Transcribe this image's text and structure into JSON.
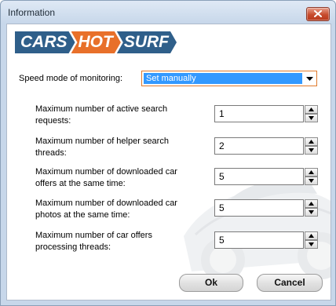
{
  "window": {
    "title": "Information"
  },
  "logo": {
    "segments": [
      {
        "text": "CARS",
        "color": "#2f5f8a"
      },
      {
        "text": "HOT",
        "color": "#e8702a"
      },
      {
        "text": "SURF",
        "color": "#2f5f8a"
      }
    ]
  },
  "speed_mode": {
    "label": "Speed mode of monitoring:",
    "selected": "Set manually"
  },
  "settings": [
    {
      "label_line1": "Maximum number of active search",
      "label_line2": "requests:",
      "value": "1"
    },
    {
      "label_line1": "Maximum number of helper search",
      "label_line2": "threads:",
      "value": "2"
    },
    {
      "label_line1": "Maximum number of downloaded car",
      "label_line2": "offers at the same time:",
      "value": "5"
    },
    {
      "label_line1": "Maximum number of downloaded car",
      "label_line2": "photos at the same time:",
      "value": "5"
    },
    {
      "label_line1": "Maximum number of car offers",
      "label_line2": "processing threads:",
      "value": "5"
    }
  ],
  "buttons": {
    "ok": "Ok",
    "cancel": "Cancel"
  },
  "colors": {
    "accent_select_border": "#e07a2c",
    "selection_highlight": "#3399ff"
  }
}
